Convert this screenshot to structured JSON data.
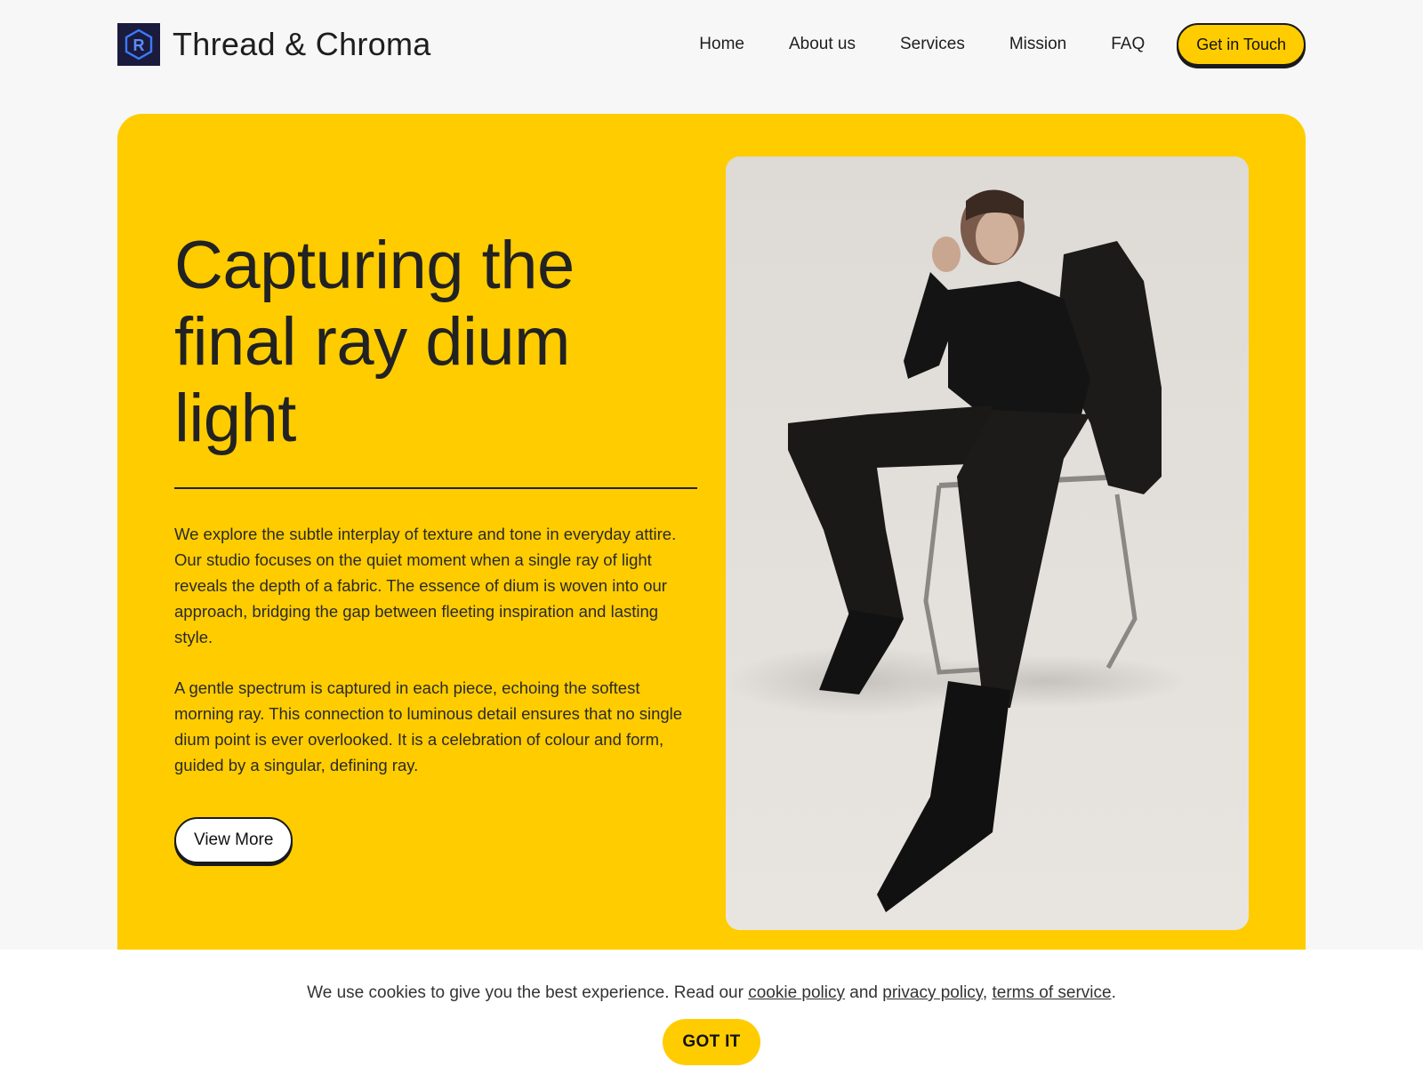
{
  "brand": {
    "name": "Thread & Chroma",
    "logo_letter": "R",
    "logo_color": "#1b1b3d",
    "accent": "#3a7bff"
  },
  "nav": {
    "links": [
      "Home",
      "About us",
      "Services",
      "Mission",
      "FAQ"
    ],
    "cta_label": "Get in Touch"
  },
  "hero": {
    "title": "Capturing the final ray dium light",
    "paragraphs": [
      "We explore the subtle interplay of texture and tone in everyday attire. Our studio focuses on the quiet moment when a single ray of light reveals the depth of a fabric. The essence of dium is woven into our approach, bridging the gap between fleeting inspiration and lasting style.",
      "A gentle spectrum is captured in each piece, echoing the softest morning ray. This connection to luminous detail ensures that no single dium point is ever overlooked. It is a celebration of colour and form, guided by a singular, defining ray."
    ],
    "button_label": "View More",
    "background": "#ffcc00"
  },
  "cookie": {
    "text_before": "We use cookies to give you the best experience. Read our ",
    "cookie_policy": "cookie policy",
    "and": " and ",
    "privacy_policy": "privacy policy",
    "comma": ", ",
    "terms": "terms of service",
    "period": ".",
    "button_label": "GOT IT"
  }
}
